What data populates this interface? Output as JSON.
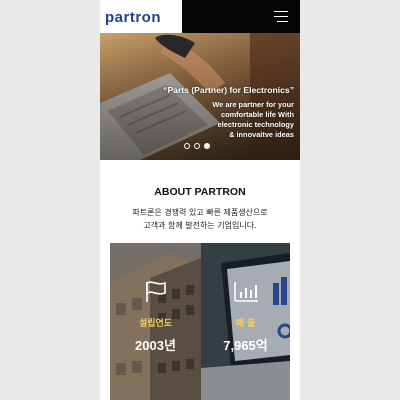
{
  "header": {
    "logo_text": "partron",
    "menu_icon": "hamburger-menu-icon"
  },
  "hero": {
    "title": "“Parts (Partner) for Electronics”",
    "subtitle_lines": [
      "We are partner for your",
      "comfortable life With",
      "electronic technology",
      "& innovaitve ideas"
    ],
    "slide_count": 3,
    "active_slide": 3
  },
  "about": {
    "title": "ABOUT PARTRON",
    "desc_lines": [
      "파트론은 경쟁력 있고 빠른 제품생산으로",
      "고객과 함께 발전하는 기업입니다."
    ]
  },
  "stats": [
    {
      "label": "설립연도",
      "value": "2003년",
      "icon": "flag-icon"
    },
    {
      "label": "매  출",
      "value": "7,965억",
      "icon": "bar-chart-icon"
    }
  ],
  "colors": {
    "header_black": "#050505",
    "brand_blue": "#1f3f8f",
    "stat_label_yellow": "#f2cf63"
  }
}
